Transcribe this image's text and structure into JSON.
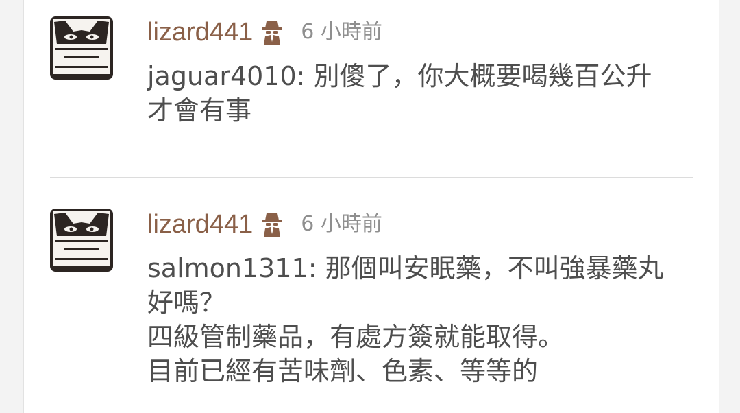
{
  "comments": [
    {
      "username": "lizard441",
      "badge_icon": "spy-icon",
      "time": "6 小時前",
      "lines": [
        "jaguar4010: 別傻了，你大概要喝幾百公升",
        "才會有事"
      ]
    },
    {
      "username": "lizard441",
      "badge_icon": "spy-icon",
      "time": "6 小時前",
      "lines": [
        "salmon1311: 那個叫安眠藥，不叫強暴藥丸",
        "好嗎？",
        "四級管制藥品，有處方簽就能取得。",
        "目前已經有苦味劑、色素、等等的"
      ]
    }
  ],
  "colors": {
    "username": "#8a6048",
    "badge": "#8a6048",
    "time": "#8f8f8f",
    "text": "#4e4e4e",
    "divider": "#dcdcdc"
  }
}
